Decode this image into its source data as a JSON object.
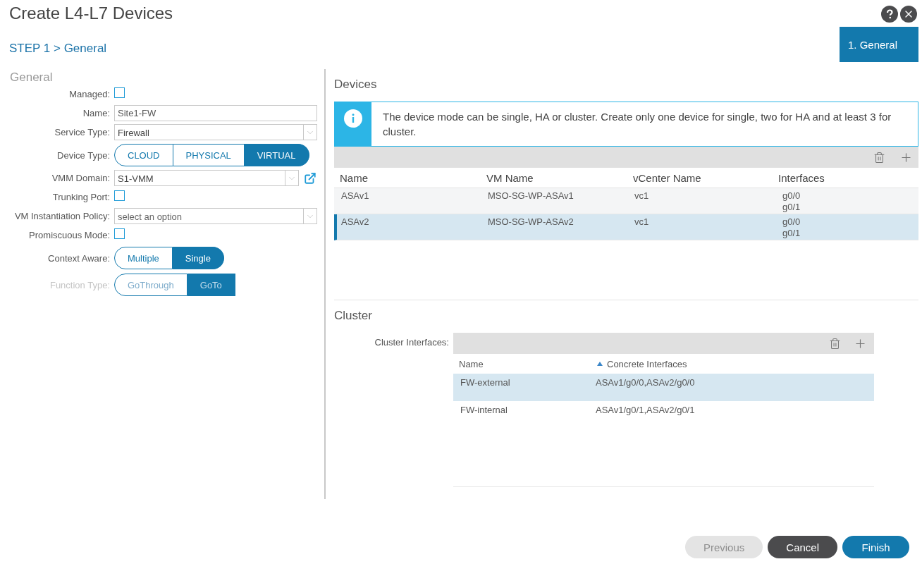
{
  "window": {
    "title": "Create L4-L7 Devices"
  },
  "step_label": "STEP 1 > General",
  "steps": [
    {
      "label": "1. General",
      "selected": true
    }
  ],
  "general": {
    "heading": "General",
    "fields": [
      {
        "kind": "checkbox",
        "label": "Managed:",
        "checked": false
      },
      {
        "kind": "text",
        "label": "Name:",
        "value": "Site1-FW"
      },
      {
        "kind": "select",
        "label": "Service Type:",
        "value": "Firewall"
      },
      {
        "kind": "segmented",
        "label": "Device Type:",
        "disabled": false,
        "options": [
          {
            "label": "CLOUD",
            "selected": false
          },
          {
            "label": "PHYSICAL",
            "selected": false
          },
          {
            "label": "VIRTUAL",
            "selected": true
          }
        ]
      },
      {
        "kind": "select",
        "label": "VMM Domain:",
        "value": "S1-VMM",
        "link": true
      },
      {
        "kind": "checkbox",
        "label": "Trunking Port:",
        "checked": false
      },
      {
        "kind": "select",
        "label": "VM Instantiation Policy:",
        "placeholder": "select an option"
      },
      {
        "kind": "checkbox",
        "label": "Promiscuous Mode:",
        "checked": false
      },
      {
        "kind": "segmented",
        "label": "Context Aware:",
        "disabled": false,
        "options": [
          {
            "label": "Multiple",
            "selected": false
          },
          {
            "label": "Single",
            "selected": true
          }
        ]
      },
      {
        "kind": "segmented",
        "label": "Function Type:",
        "disabled": true,
        "options": [
          {
            "label": "GoThrough",
            "selected": false
          },
          {
            "label": "GoTo",
            "selected": true
          }
        ]
      }
    ]
  },
  "devices": {
    "heading": "Devices",
    "info": "The device mode can be single, HA or cluster. Create only one device for single, two for HA and at least 3 for cluster.",
    "columns": [
      "Name",
      "VM Name",
      "vCenter Name",
      "Interfaces"
    ],
    "rows": [
      {
        "name": "ASAv1",
        "vm_name": "MSO-SG-WP-ASAv1",
        "vcenter": "vc1",
        "interfaces": [
          "g0/0",
          "g0/1"
        ],
        "selected": false
      },
      {
        "name": "ASAv2",
        "vm_name": "MSO-SG-WP-ASAv2",
        "vcenter": "vc1",
        "interfaces": [
          "g0/0",
          "g0/1"
        ],
        "selected": true
      }
    ]
  },
  "cluster": {
    "heading": "Cluster",
    "label": "Cluster Interfaces:",
    "columns": [
      {
        "label": "Name",
        "sorted": false
      },
      {
        "label": "Concrete Interfaces",
        "sorted": true
      }
    ],
    "rows": [
      {
        "name": "FW-external",
        "interfaces": "ASAv1/g0/0,ASAv2/g0/0",
        "selected": true
      },
      {
        "name": "FW-internal",
        "interfaces": "ASAv1/g0/1,ASAv2/g0/1",
        "selected": false
      }
    ]
  },
  "buttons": [
    {
      "label": "Previous",
      "kind": "light",
      "disabled": true
    },
    {
      "label": "Cancel",
      "kind": "dark",
      "disabled": false
    },
    {
      "label": "Finish",
      "kind": "primary",
      "disabled": false
    }
  ]
}
